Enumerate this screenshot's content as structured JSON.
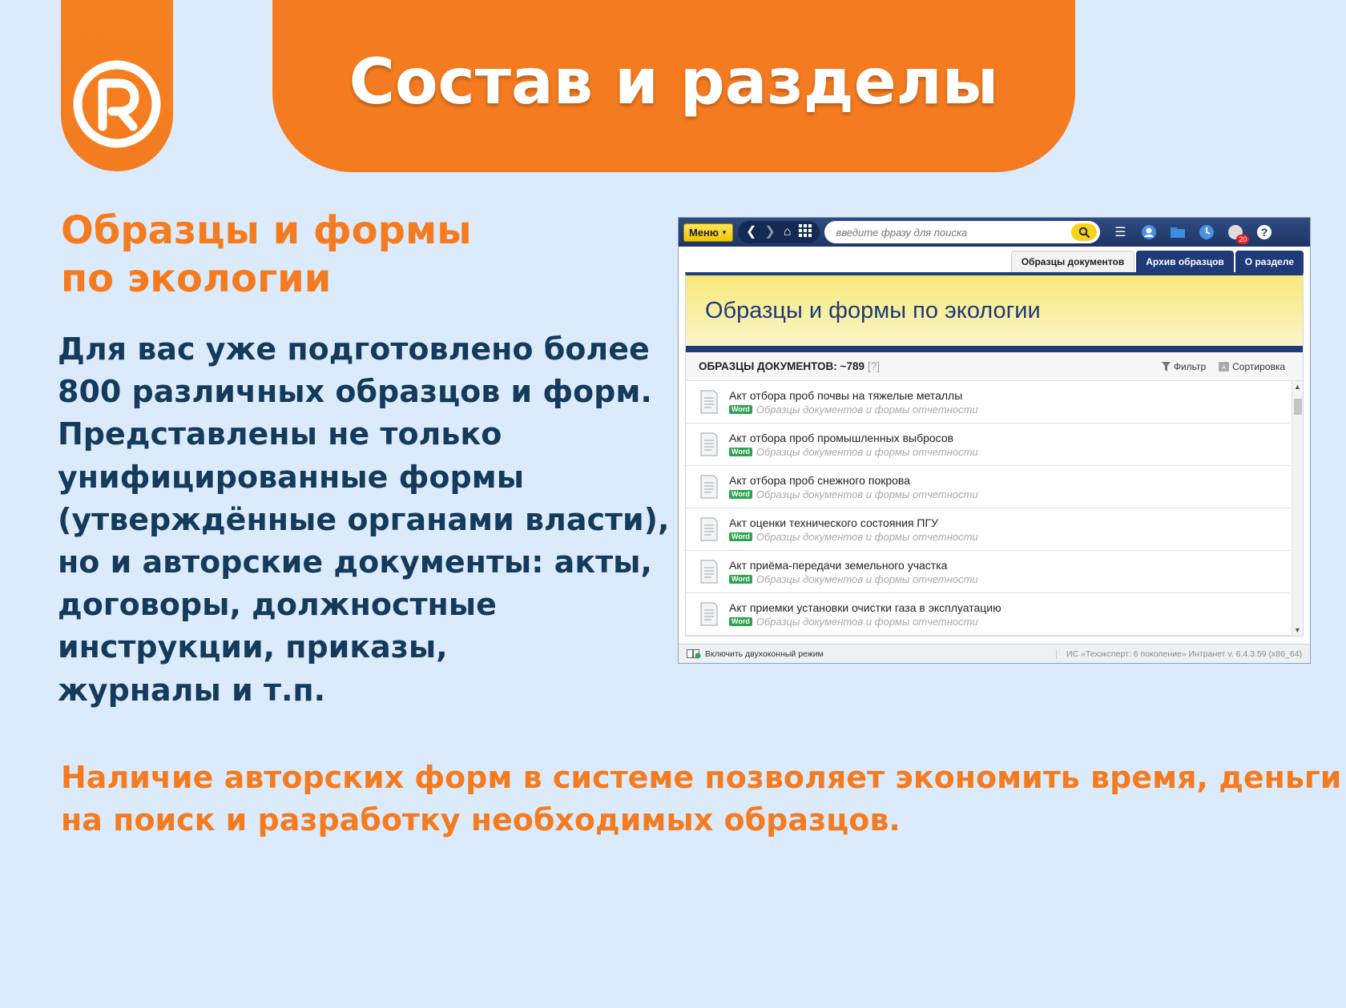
{
  "slide": {
    "title": "Состав и разделы",
    "subtitle_lines": [
      "Образцы и формы",
      "по экологии"
    ],
    "body_lines": [
      "Для вас уже подготовлено более",
      "800 различных образцов и форм.",
      "Представлены не только",
      "унифицированные формы",
      "(утверждённые органами власти),",
      "но и авторские документы: акты,",
      "договоры, должностные",
      "инструкции, приказы,",
      "журналы и т.п."
    ],
    "bottom_lines": [
      "Наличие авторских форм в системе позволяет экономить время, деньги",
      "на поиск и разработку необходимых образцов."
    ],
    "logo_icon": "registered-r-icon"
  },
  "app": {
    "toolbar": {
      "menu_label": "Меню",
      "search_placeholder": "введите фразу для поиска",
      "icons": [
        "back-icon",
        "forward-icon",
        "home-icon",
        "grid-icon",
        "search-icon",
        "hamburger-icon",
        "user-icon",
        "folder-icon",
        "clock-icon",
        "notifications-icon",
        "help-icon"
      ],
      "notifications_count": "20"
    },
    "tabs": [
      {
        "label": "Образцы документов",
        "active": true
      },
      {
        "label": "Архив образцов",
        "active": false
      },
      {
        "label": "О разделе",
        "active": false
      }
    ],
    "banner_title": "Образцы и формы по экологии",
    "list_header": {
      "title": "ОБРАЗЦЫ ДОКУМЕНТОВ: ~789",
      "help": "[?]",
      "filter_label": "Фильтр",
      "sort_label": "Сортировка"
    },
    "items": [
      {
        "title": "Акт отбора проб почвы на тяжелые металлы",
        "tag": "Word",
        "category": "Образцы документов и формы отчетности"
      },
      {
        "title": "Акт отбора проб промышленных выбросов",
        "tag": "Word",
        "category": "Образцы документов и формы отчетности"
      },
      {
        "title": "Акт отбора проб снежного покрова",
        "tag": "Word",
        "category": "Образцы документов и формы отчетности"
      },
      {
        "title": "Акт оценки технического состояния ПГУ",
        "tag": "Word",
        "category": "Образцы документов и формы отчетности"
      },
      {
        "title": "Акт приёма-передачи земельного участка",
        "tag": "Word",
        "category": "Образцы документов и формы отчетности"
      },
      {
        "title": "Акт приемки установки очистки газа в эксплуатацию",
        "tag": "Word",
        "category": "Образцы документов и формы отчетности"
      }
    ],
    "status": {
      "dual_window": "Включить двухоконный режим",
      "version": "ИС «Техэксперт: 6 поколение» Интранет v. 6.4.3.59 (x86_64)"
    }
  }
}
